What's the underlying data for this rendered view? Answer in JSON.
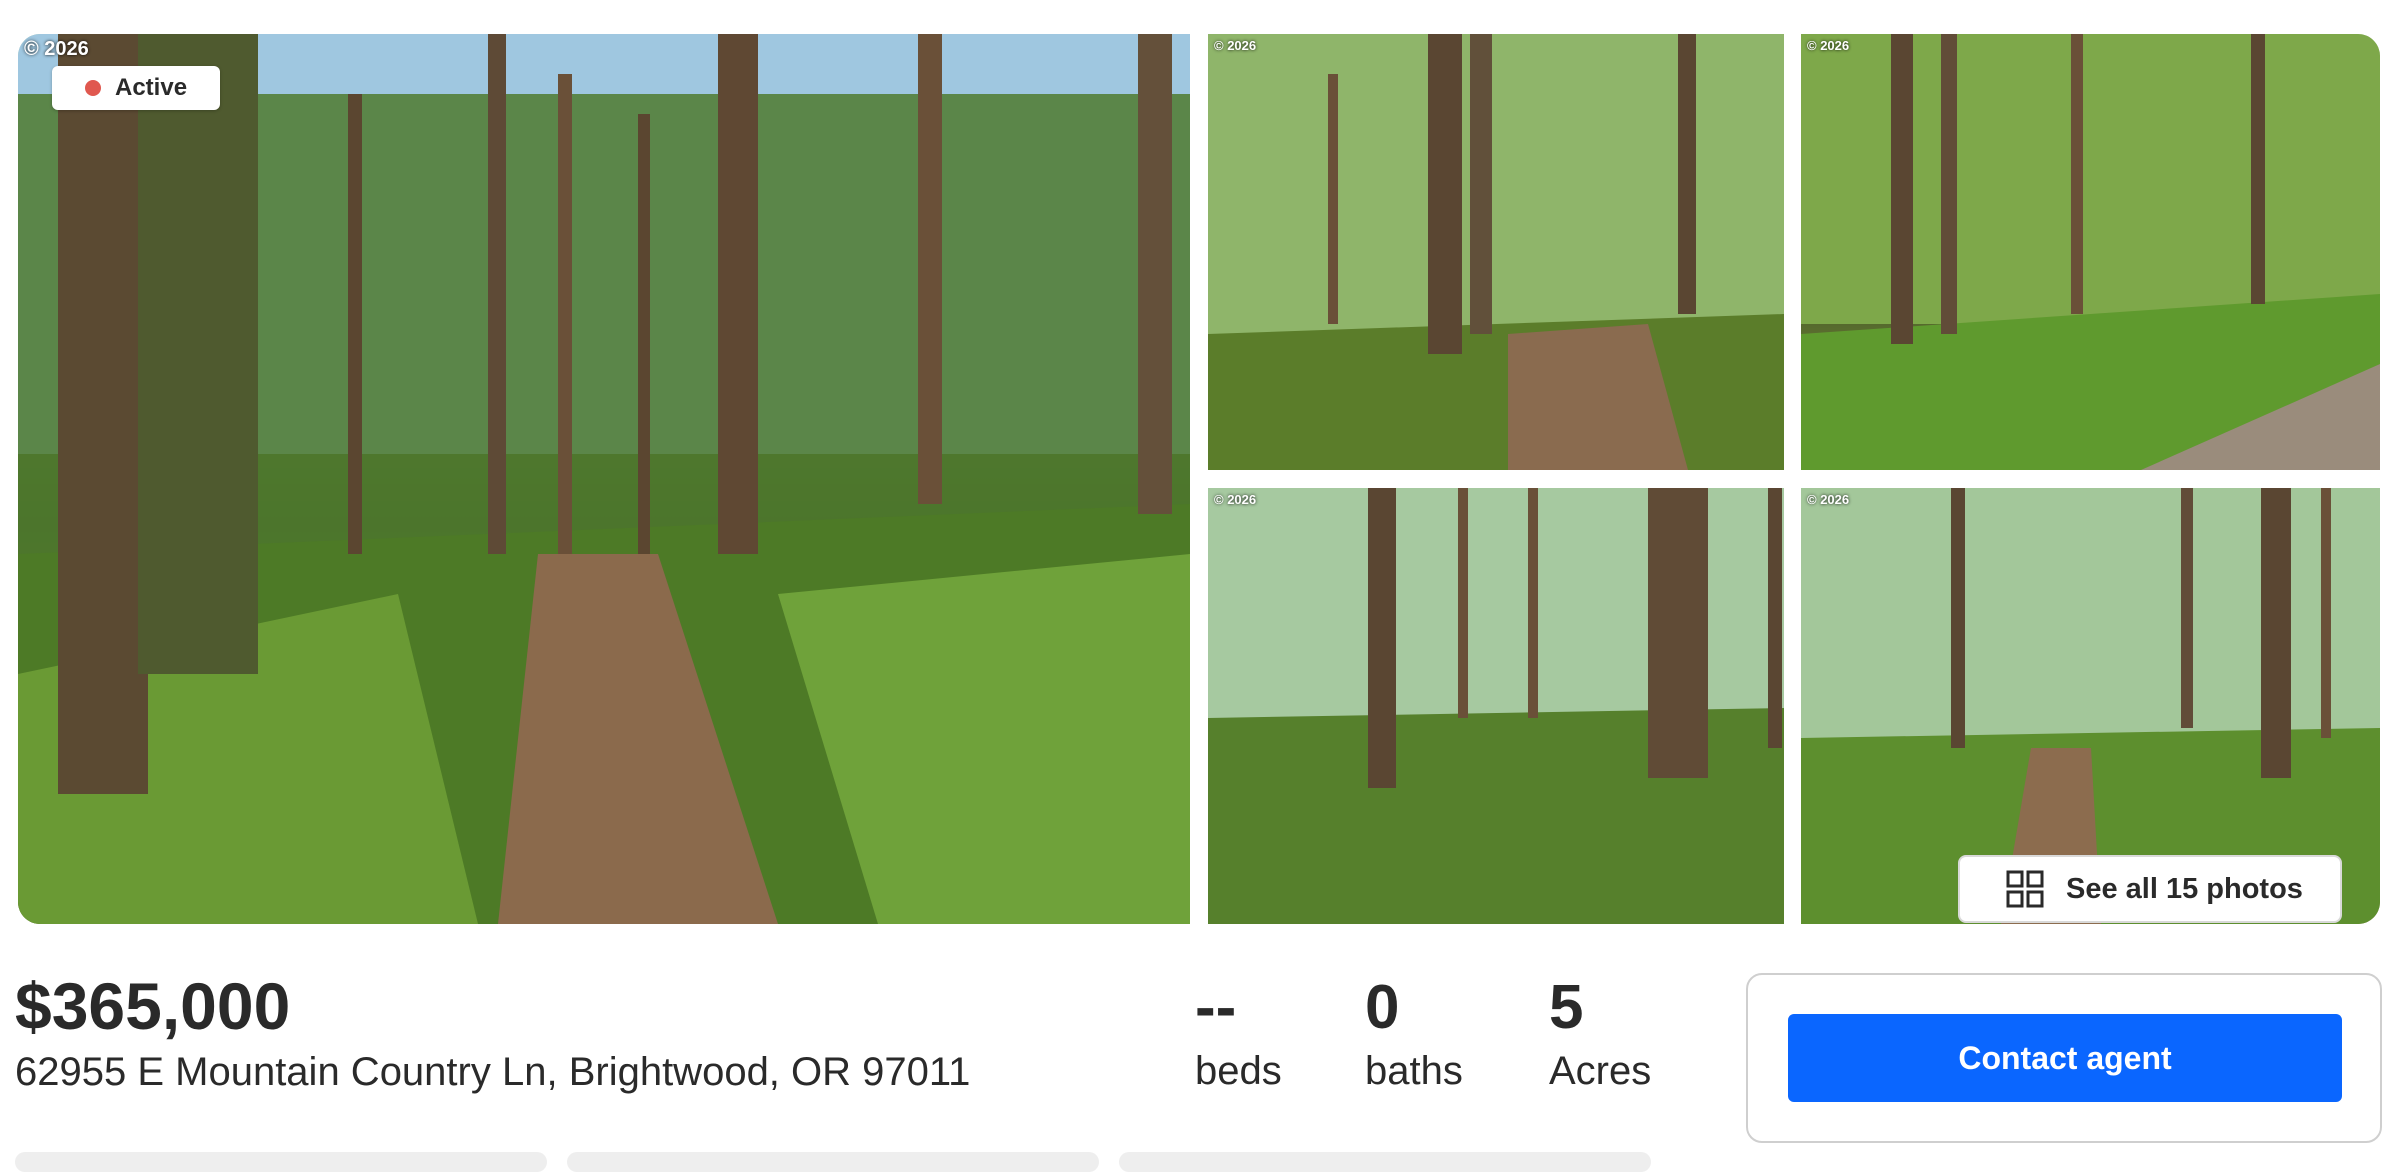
{
  "gallery": {
    "copyright": "© 2026",
    "status_badge": "Active",
    "see_all_label": "See all 15 photos",
    "icons": {
      "status": "status-dot-icon",
      "see_all": "grid-icon"
    }
  },
  "listing": {
    "price": "$365,000",
    "address": "62955 E Mountain Country Ln, Brightwood, OR 97011"
  },
  "stats": {
    "beds": {
      "value": "--",
      "label": "beds"
    },
    "baths": {
      "value": "0",
      "label": "baths"
    },
    "acres": {
      "value": "5",
      "label": "Acres"
    }
  },
  "contact": {
    "button_label": "Contact agent"
  },
  "colors": {
    "accent": "#0a66ff",
    "status_active": "#e0584f",
    "text": "#2a2a2a"
  }
}
